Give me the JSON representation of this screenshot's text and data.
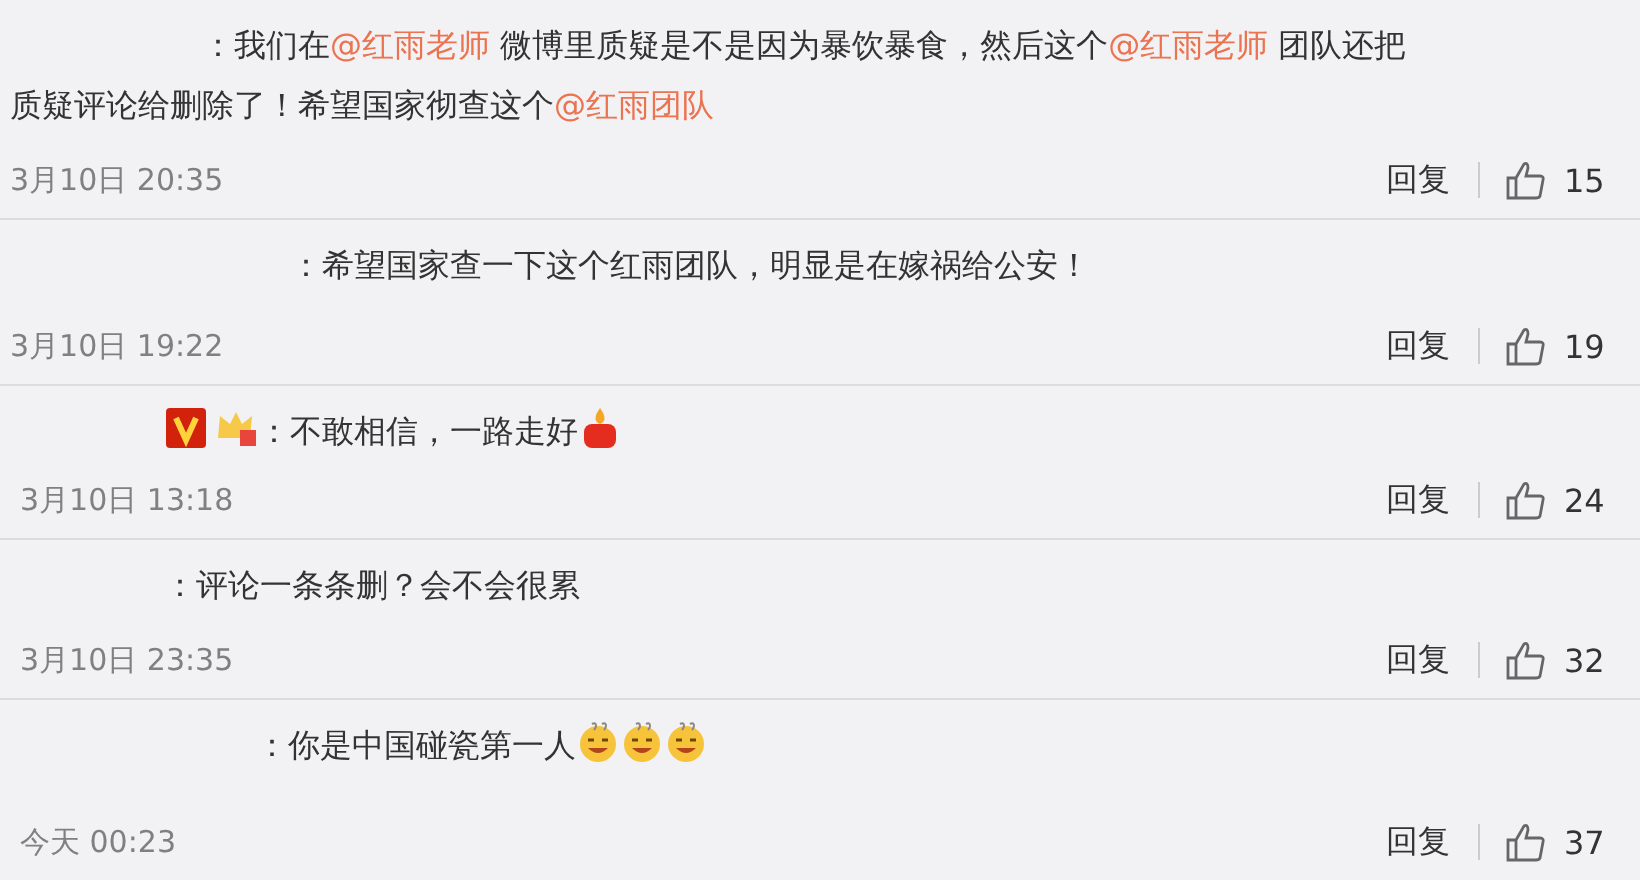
{
  "comments": [
    {
      "content": [
        {
          "kind": "text",
          "text": "：我们在"
        },
        {
          "kind": "mention",
          "text": "@红雨老师"
        },
        {
          "kind": "text",
          "text": " 微博里质疑是不是因为暴饮暴食，然后这个"
        },
        {
          "kind": "mention",
          "text": "@红雨老师"
        },
        {
          "kind": "text",
          "text": " 团队还把"
        },
        {
          "kind": "break"
        },
        {
          "kind": "text",
          "text": "质疑评论给删除了！希望国家彻查这个"
        },
        {
          "kind": "mention",
          "text": "@红雨团队"
        }
      ],
      "time": "3月10日 20:35",
      "reply": "回复",
      "likes": "15"
    },
    {
      "content": [
        {
          "kind": "text",
          "text": "：希望国家查一下这个红雨团队，明显是在嫁祸给公安！"
        }
      ],
      "time": "3月10日 19:22",
      "reply": "回复",
      "likes": "19"
    },
    {
      "badges": [
        {
          "kind": "verified"
        },
        {
          "kind": "crown"
        }
      ],
      "content": [
        {
          "kind": "text",
          "text": "：不敢相信，一路走好"
        },
        {
          "kind": "candle"
        }
      ],
      "time": "3月10日 13:18",
      "reply": "回复",
      "likes": "24"
    },
    {
      "content": [
        {
          "kind": "text",
          "text": "：评论一条条删？会不会很累"
        }
      ],
      "time": "3月10日 23:35",
      "reply": "回复",
      "likes": "32"
    },
    {
      "content": [
        {
          "kind": "text",
          "text": "：你是中国碰瓷第一人"
        },
        {
          "kind": "grin"
        },
        {
          "kind": "grin"
        },
        {
          "kind": "grin"
        }
      ],
      "time": "今天 00:23",
      "reply": "回复",
      "likes": "37"
    }
  ]
}
